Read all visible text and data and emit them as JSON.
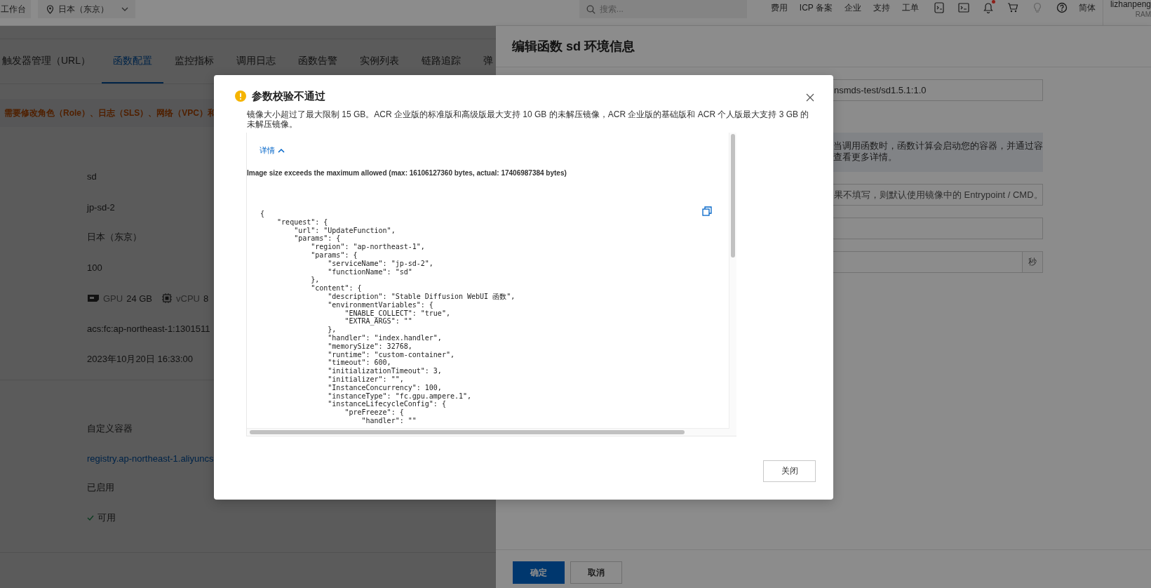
{
  "top_bar": {
    "workspace": "工作台",
    "region": "日本（东京）",
    "search": {
      "placeholder": "搜索..."
    },
    "links": [
      "费用",
      "ICP 备案",
      "企业",
      "支持",
      "工单"
    ],
    "notification_unread": true,
    "language": "简体",
    "user": {
      "name": "lizhanpeng",
      "role": "RAM"
    }
  },
  "function_page": {
    "tabs": [
      {
        "label": "触发器管理（URL）",
        "selected": false
      },
      {
        "label": "函数配置",
        "selected": true
      },
      {
        "label": "监控指标",
        "selected": false
      },
      {
        "label": "调用日志",
        "selected": false
      },
      {
        "label": "函数告警",
        "selected": false
      },
      {
        "label": "实例列表",
        "selected": false
      },
      {
        "label": "链路追踪",
        "selected": false
      },
      {
        "label": "弹",
        "selected": false
      }
    ],
    "notice": "需要修改角色（Role）、日志（SLS）、网络（VPC）和",
    "basic_info": [
      {
        "kind": "text",
        "value": "sd"
      },
      {
        "kind": "text",
        "value": "jp-sd-2"
      },
      {
        "kind": "text",
        "value": "日本（东京）"
      },
      {
        "kind": "text",
        "value": "100"
      },
      {
        "kind": "resources",
        "gpu_label": "GPU",
        "gpu_value": "24 GB",
        "cpu_label": "vCPU",
        "cpu_value": "8"
      },
      {
        "kind": "text",
        "value": "acs:fc:ap-northeast-1:1301511"
      },
      {
        "kind": "text",
        "value": "2023年10月20日 16:33:00"
      }
    ],
    "runtime_info": [
      {
        "kind": "text",
        "value": "自定义容器"
      },
      {
        "kind": "link",
        "value": "registry.ap-northeast-1.aliyuncs"
      },
      {
        "kind": "text",
        "value": "已启用"
      },
      {
        "kind": "status",
        "value": "可用",
        "ok": true
      }
    ]
  },
  "drawer": {
    "title": "编辑函数 sd 环境信息",
    "image_field": {
      "value": "nsmds-test/sd1.5.1:1.0"
    },
    "info_lines": [
      "当调用函数时，函数计算会启动您的容器，并通过容",
      "查看更多详情。"
    ],
    "command_field": {
      "placeholder": "果不填写，则默认使用镜像中的 Entrypoint / CMD。"
    },
    "timeout_field": {
      "suffix": "秒"
    },
    "buttons": [
      {
        "label": "确定",
        "kind": "primary"
      },
      {
        "label": "取消",
        "kind": "default"
      }
    ]
  },
  "dialog": {
    "title": "参数校验不通过",
    "message": "镜像大小超过了最大限制 15 GB。ACR 企业版的标准版和高级版最大支持 10 GB 的未解压镜像，ACR 企业版的基础版和 ACR 个人版最大支持 3 GB 的未解压镜像。",
    "details": {
      "label": "详情",
      "expanded": true,
      "error": "Image size exceeds the maximum allowed (max: 16106127360 bytes, actual: 17406987384 bytes)",
      "code_lines": [
        "{",
        "    \"request\": {",
        "        \"url\": \"UpdateFunction\",",
        "        \"params\": {",
        "            \"region\": \"ap-northeast-1\",",
        "            \"params\": {",
        "                \"serviceName\": \"jp-sd-2\",",
        "                \"functionName\": \"sd\"",
        "            },",
        "            \"content\": {",
        "                \"description\": \"Stable Diffusion WebUI 函数\",",
        "                \"environmentVariables\": {",
        "                    \"ENABLE_COLLECT\": \"true\",",
        "                    \"EXTRA_ARGS\": \"\"",
        "                },",
        "                \"handler\": \"index.handler\",",
        "                \"memorySize\": 32768,",
        "                \"runtime\": \"custom-container\",",
        "                \"timeout\": 600,",
        "                \"initializationTimeout\": 3,",
        "                \"initializer\": \"\",",
        "                \"InstanceConcurrency\": 100,",
        "                \"instanceType\": \"fc.gpu.ampere.1\",",
        "                \"instanceLifecycleConfig\": {",
        "                    \"preFreeze\": {",
        "                        \"handler\": \"\""
      ]
    },
    "close_button": "关闭"
  }
}
